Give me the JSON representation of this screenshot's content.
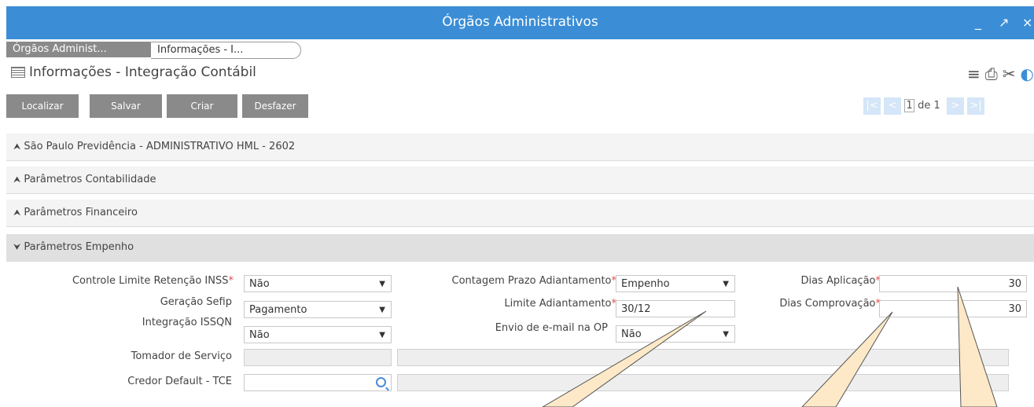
{
  "window": {
    "title": "Órgãos Administrativos",
    "minimize": "_",
    "maximize": "↗",
    "close": "×"
  },
  "breadcrumbs": [
    "Órgãos Administ...",
    "Informações - I..."
  ],
  "form": {
    "title": "Informações - Integração Contábil"
  },
  "toolbar": {
    "buttons": [
      "Localizar",
      "Salvar",
      "Criar",
      "Desfazer"
    ],
    "icons": [
      "menu-icon",
      "print-icon",
      "tools-icon",
      "help-icon"
    ]
  },
  "pager": {
    "first": "|<",
    "prev": "<",
    "current": "1",
    "of_label": "de 1",
    "next": ">",
    "last": ">|"
  },
  "sections": [
    {
      "label": "São Paulo Previdência - ADMINISTRATIVO HML - 2602",
      "chevron": "≈",
      "expanded": false
    },
    {
      "label": "Parâmetros Contabilidade",
      "chevron": "≈",
      "expanded": false
    },
    {
      "label": "Parâmetros Financeiro",
      "chevron": "≈",
      "expanded": false
    },
    {
      "label": "Parâmetros Empenho",
      "chevron": "≈",
      "expanded": true
    }
  ],
  "fields": {
    "controle_limite": {
      "label": "Controle Limite Retenção INSS",
      "required": "*",
      "value": "Não"
    },
    "geracao_sefip": {
      "label": "Geração Sefip",
      "value": "Pagamento"
    },
    "integracao_issqn": {
      "label": "Integração ISSQN",
      "value": "Não"
    },
    "tomador_servico": {
      "label": "Tomador de Serviço",
      "value": ""
    },
    "credor_default": {
      "label": "Credor Default - TCE",
      "value": ""
    },
    "contagem_prazo": {
      "label": "Contagem Prazo Adiantamento",
      "required": "*",
      "value": "Empenho"
    },
    "limite_adiantamento": {
      "label": "Limite Adiantamento",
      "required": "*",
      "value": "30/12"
    },
    "envio_email": {
      "label": "Envio de e-mail na OP",
      "value": "Não"
    },
    "dias_aplicacao": {
      "label": "Dias Aplicação",
      "required": "*",
      "value": "30"
    },
    "dias_comprovacao": {
      "label": "Dias Comprovação",
      "required": "*",
      "value": "30"
    }
  },
  "colors": {
    "titlebar": "#3b8ed6",
    "button": "#8a8a8a",
    "required": "#e84a4a",
    "callout_fill": "#fde9c8"
  }
}
